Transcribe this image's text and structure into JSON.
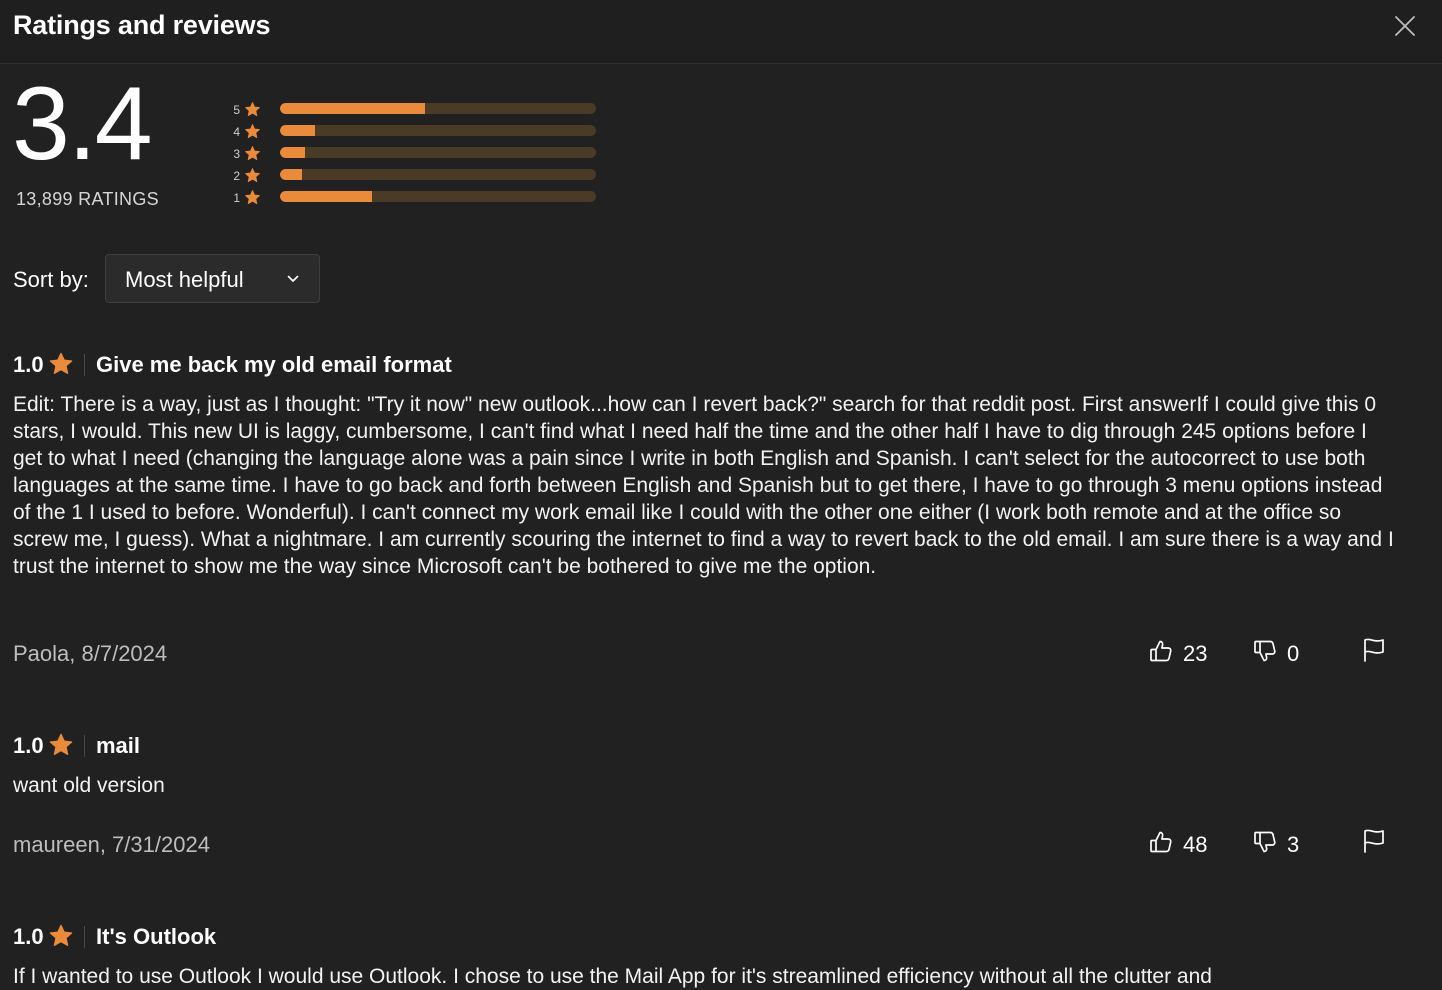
{
  "header": {
    "title": "Ratings and reviews"
  },
  "summary": {
    "average": "3.4",
    "count_label": "13,899 RATINGS",
    "accent_color": "#ea8a3b",
    "histogram": [
      {
        "stars": "5",
        "fraction": 0.46
      },
      {
        "stars": "4",
        "fraction": 0.11
      },
      {
        "stars": "3",
        "fraction": 0.08
      },
      {
        "stars": "2",
        "fraction": 0.07
      },
      {
        "stars": "1",
        "fraction": 0.29
      }
    ]
  },
  "sort": {
    "label": "Sort by:",
    "value": "Most helpful"
  },
  "reviews": [
    {
      "score": "1.0",
      "title": "Give me back my old email format",
      "body": "Edit: There is a way, just as I thought: \"Try it now\" new outlook...how can I revert back?\" search for that reddit post. First answerIf I could give this 0 stars, I would. This new UI is laggy, cumbersome, I can't find what I need half the time and the other half I have to dig through 245 options before I get to what I need (changing the language alone was a pain since I write in both English and Spanish. I can't select for the autocorrect to use both languages at the same time. I have to go back and forth between English and Spanish but to get there, I have to go through 3 menu options instead of the 1 I used to before. Wonderful). I can't connect my work email like I could with the other one either (I work both remote and at the office so screw me, I guess). What a nightmare. I am currently scouring the internet to find a way to revert back to the old email. I am sure there is a way and I trust the internet to show me the way since Microsoft can't be bothered to give me the option.",
      "author": "Paola, 8/7/2024",
      "likes": "23",
      "dislikes": "0"
    },
    {
      "score": "1.0",
      "title": "mail",
      "body": "want old version",
      "author": "maureen, 7/31/2024",
      "likes": "48",
      "dislikes": "3"
    },
    {
      "score": "1.0",
      "title": "It's Outlook",
      "body": "If I wanted to use Outlook I would use Outlook. I chose to use the Mail App for it's streamlined efficiency without all the clutter and"
    }
  ]
}
